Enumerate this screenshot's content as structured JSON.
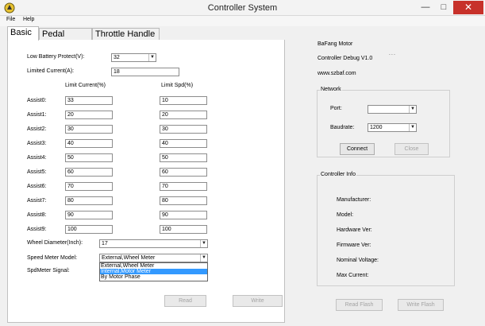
{
  "window": {
    "title": "Controller System"
  },
  "menu": [
    "File",
    "Help"
  ],
  "tabs": [
    "Basic",
    "Pedal Assist",
    "Throttle Handle"
  ],
  "basic": {
    "low_battery_label": "Low Battery Protect(V):",
    "low_battery_value": "32",
    "limited_current_label": "Limited Current(A):",
    "limited_current_value": "18",
    "limit_current_header": "Limit Current(%)",
    "limit_speed_header": "Limit Spd(%)",
    "assists": [
      {
        "label": "Assist0:",
        "current": "33",
        "speed": "10"
      },
      {
        "label": "Assist1:",
        "current": "20",
        "speed": "20"
      },
      {
        "label": "Assist2:",
        "current": "30",
        "speed": "30"
      },
      {
        "label": "Assist3:",
        "current": "40",
        "speed": "40"
      },
      {
        "label": "Assist4:",
        "current": "50",
        "speed": "50"
      },
      {
        "label": "Assist5:",
        "current": "60",
        "speed": "60"
      },
      {
        "label": "Assist6:",
        "current": "70",
        "speed": "70"
      },
      {
        "label": "Assist7:",
        "current": "80",
        "speed": "80"
      },
      {
        "label": "Assist8:",
        "current": "90",
        "speed": "90"
      },
      {
        "label": "Assist9:",
        "current": "100",
        "speed": "100"
      }
    ],
    "wheel_diameter_label": "Wheel Diameter(Inch):",
    "wheel_diameter_value": "17",
    "speed_meter_model_label": "Speed Meter Model:",
    "speed_meter_model_value": "External,Wheel Meter",
    "speed_meter_options": [
      "External,Wheel Meter",
      "Internal,Motor Meter",
      "By Motor Phase"
    ],
    "spd_meter_signal_label": "SpdMeter Signal:",
    "read_button": "Read",
    "write_button": "Write"
  },
  "info": {
    "line1": "BaFang Motor",
    "line2": "Controller Debug V1.0",
    "line2_extra": "- - -",
    "line3": "www.szbaf.com"
  },
  "network": {
    "title": "Network",
    "port_label": "Port:",
    "port_value": "",
    "baudrate_label": "Baudrate:",
    "baudrate_value": "1200",
    "connect_button": "Connect",
    "close_button": "Close"
  },
  "controller_info": {
    "title": "Controller Info",
    "labels": [
      "Manufacturer:",
      "Model:",
      "Hardware Ver:",
      "Firmware Ver:",
      "Nominal Voltage:",
      "Max Current:"
    ]
  },
  "flash": {
    "read_flash_button": "Read Flash",
    "write_flash_button": "Write Flash"
  },
  "colors": {
    "close_button": "#c7312a",
    "selected_option": "#3399ff"
  }
}
